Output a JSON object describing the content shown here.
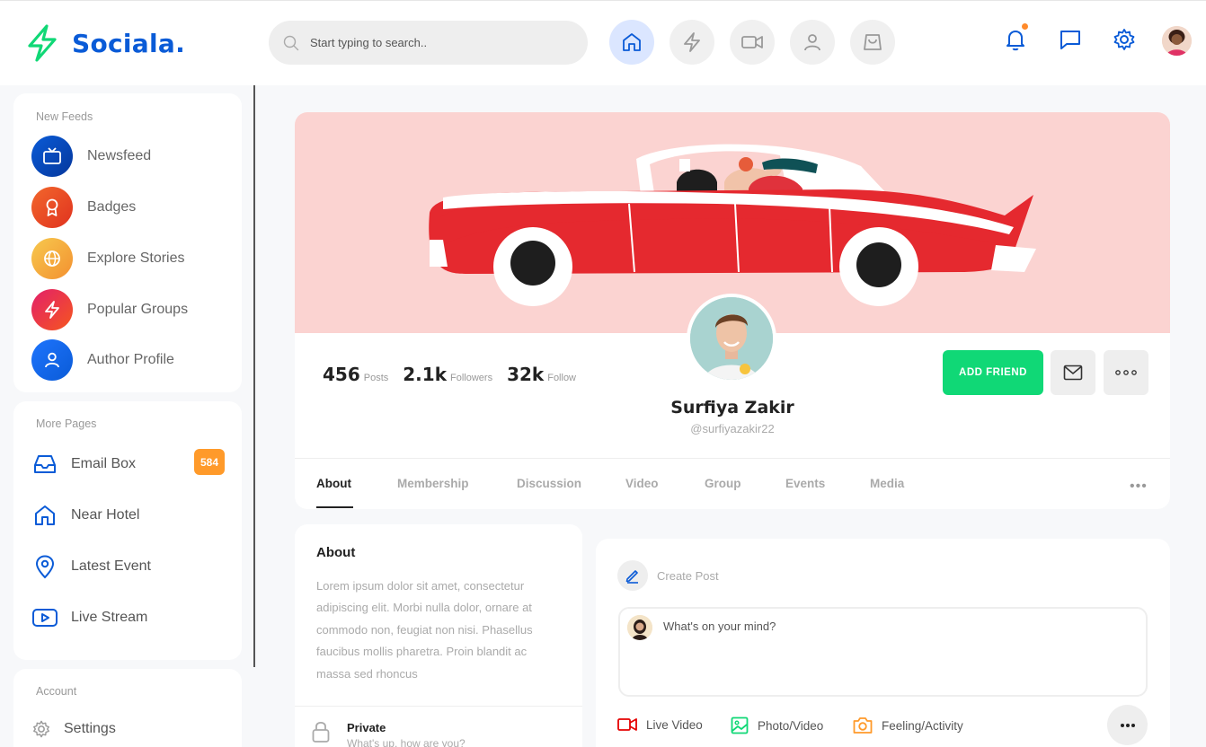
{
  "app": {
    "name": "Sociala.",
    "brand_color": "#0a5bd7",
    "accent_green": "#10d876"
  },
  "search": {
    "placeholder": "Start typing to search.."
  },
  "top_nav": {
    "items": [
      {
        "icon": "home-icon",
        "active": true
      },
      {
        "icon": "bolt-icon",
        "active": false
      },
      {
        "icon": "video-icon",
        "active": false
      },
      {
        "icon": "user-icon",
        "active": false
      },
      {
        "icon": "shopping-bag-icon",
        "active": false
      }
    ],
    "right_icons": [
      "bell-icon",
      "chat-icon",
      "settings-icon",
      "user-avatar"
    ]
  },
  "sidebar": {
    "new_feeds": {
      "heading": "New Feeds",
      "items": [
        {
          "label": "Newsfeed",
          "icon": "tv-icon"
        },
        {
          "label": "Badges",
          "icon": "award-icon"
        },
        {
          "label": "Explore Stories",
          "icon": "globe-icon"
        },
        {
          "label": "Popular Groups",
          "icon": "bolt-icon"
        },
        {
          "label": "Author Profile",
          "icon": "user-icon"
        }
      ]
    },
    "more_pages": {
      "heading": "More Pages",
      "items": [
        {
          "label": "Email Box",
          "icon": "inbox-icon",
          "badge": "584"
        },
        {
          "label": "Near Hotel",
          "icon": "home-icon"
        },
        {
          "label": "Latest Event",
          "icon": "map-pin-icon"
        },
        {
          "label": "Live Stream",
          "icon": "youtube-icon"
        }
      ]
    },
    "account": {
      "heading": "Account",
      "items": [
        {
          "label": "Settings",
          "icon": "settings-icon"
        }
      ]
    }
  },
  "profile": {
    "name": "Surfiya Zakir",
    "handle": "@surfiyazakir22",
    "stats": [
      {
        "value": "456",
        "label": "Posts"
      },
      {
        "value": "2.1k",
        "label": "Followers"
      },
      {
        "value": "32k",
        "label": "Follow"
      }
    ],
    "add_friend_label": "ADD FRIEND",
    "tabs": [
      "About",
      "Membership",
      "Discussion",
      "Video",
      "Group",
      "Events",
      "Media"
    ],
    "active_tab": "About"
  },
  "about": {
    "title": "About",
    "text": "Lorem ipsum dolor sit amet, consectetur adipiscing elit. Morbi nulla dolor, ornare at commodo non, feugiat non nisi. Phasellus faucibus mollis pharetra. Proin blandit ac massa sed rhoncus",
    "privacy_label": "Private",
    "privacy_sub": "What's up, how are you?"
  },
  "create_post": {
    "label": "Create Post",
    "placeholder": "What's on your mind?",
    "actions": [
      {
        "label": "Live Video",
        "icon": "video-icon",
        "color": "#e50202"
      },
      {
        "label": "Photo/Video",
        "icon": "image-icon",
        "color": "#10d876"
      },
      {
        "label": "Feeling/Activity",
        "icon": "camera-icon",
        "color": "#ff9a2a"
      }
    ]
  }
}
